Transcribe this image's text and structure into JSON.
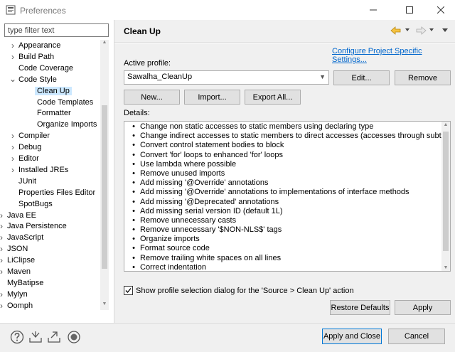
{
  "window": {
    "title": "Preferences",
    "icon": "preferences-app-icon"
  },
  "filter": {
    "placeholder": "type filter text"
  },
  "tree": {
    "items": [
      {
        "label": "Appearance",
        "twisty": "collapsed"
      },
      {
        "label": "Build Path",
        "twisty": "collapsed"
      },
      {
        "label": "Code Coverage",
        "twisty": "none"
      },
      {
        "label": "Code Style",
        "twisty": "expanded"
      },
      {
        "label": "Clean Up",
        "twisty": "none",
        "selected": true
      },
      {
        "label": "Code Templates",
        "twisty": "none"
      },
      {
        "label": "Formatter",
        "twisty": "none"
      },
      {
        "label": "Organize Imports",
        "twisty": "none"
      },
      {
        "label": "Compiler",
        "twisty": "collapsed"
      },
      {
        "label": "Debug",
        "twisty": "collapsed"
      },
      {
        "label": "Editor",
        "twisty": "collapsed"
      },
      {
        "label": "Installed JREs",
        "twisty": "collapsed"
      },
      {
        "label": "JUnit",
        "twisty": "none"
      },
      {
        "label": "Properties Files Editor",
        "twisty": "none"
      },
      {
        "label": "SpotBugs",
        "twisty": "none"
      },
      {
        "label": "Java EE",
        "twisty": "collapsed"
      },
      {
        "label": "Java Persistence",
        "twisty": "collapsed"
      },
      {
        "label": "JavaScript",
        "twisty": "collapsed"
      },
      {
        "label": "JSON",
        "twisty": "collapsed"
      },
      {
        "label": "LiClipse",
        "twisty": "collapsed"
      },
      {
        "label": "Maven",
        "twisty": "collapsed"
      },
      {
        "label": "MyBatipse",
        "twisty": "none"
      },
      {
        "label": "Mylyn",
        "twisty": "collapsed"
      },
      {
        "label": "Oomph",
        "twisty": "collapsed"
      }
    ]
  },
  "page": {
    "title": "Clean Up",
    "configure_link": "Configure Project Specific Settings...",
    "active_profile_label": "Active profile:",
    "profile_value": "Sawalha_CleanUp",
    "edit_button": "Edit...",
    "remove_button": "Remove",
    "new_button": "New...",
    "import_button": "Import...",
    "export_button": "Export All...",
    "details_label": "Details:",
    "details": [
      "Change non static accesses to static members using declaring type",
      "Change indirect accesses to static members to direct accesses (accesses through subtypes)",
      "Convert control statement bodies to block",
      "Convert 'for' loops to enhanced 'for' loops",
      "Use lambda where possible",
      "Remove unused imports",
      "Add missing '@Override' annotations",
      "Add missing '@Override' annotations to implementations of interface methods",
      "Add missing '@Deprecated' annotations",
      "Add missing serial version ID (default 1L)",
      "Remove unnecessary casts",
      "Remove unnecessary '$NON-NLS$' tags",
      "Organize imports",
      "Format source code",
      "Remove trailing white spaces on all lines",
      "Correct indentation"
    ],
    "bullet": "•",
    "show_dialog_checkbox": "Show profile selection dialog for the 'Source > Clean Up' action",
    "show_dialog_checked": true,
    "restore_defaults_button": "Restore Defaults",
    "apply_button": "Apply"
  },
  "footer": {
    "apply_close_button": "Apply and Close",
    "cancel_button": "Cancel",
    "icons": [
      "help-icon",
      "import-preferences-icon",
      "export-preferences-icon",
      "record-icon"
    ]
  },
  "colors": {
    "accent": "#0078d7",
    "link": "#0066cc",
    "selection": "#cce8ff",
    "nav_arrow": "#e8a317"
  }
}
